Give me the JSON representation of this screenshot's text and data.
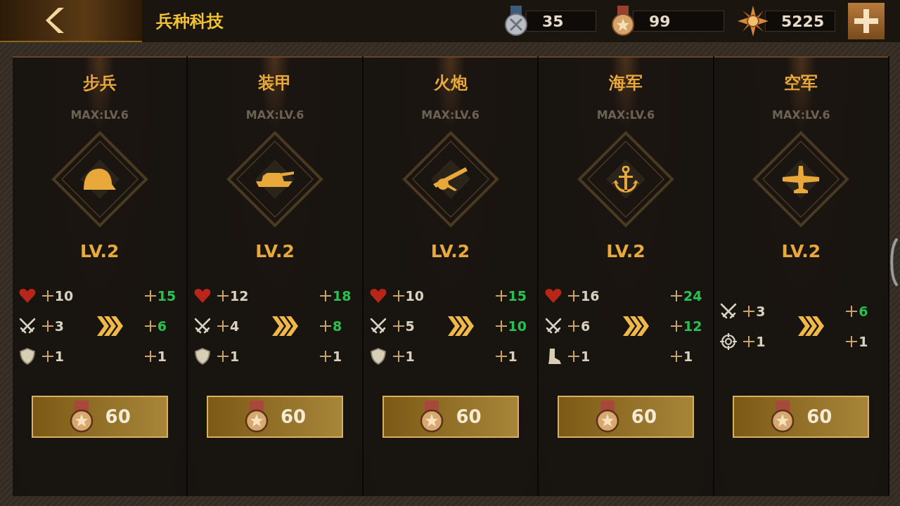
{
  "header": {
    "title": "兵种科技"
  },
  "currencies": [
    {
      "kind": "crossed-medal",
      "amount": "35"
    },
    {
      "kind": "star-medal",
      "amount": "99"
    },
    {
      "kind": "star-badge",
      "amount": "5225"
    }
  ],
  "branches": [
    {
      "name": "步兵",
      "max_level": "MAX:LV.6",
      "kind": "helmet",
      "level": "LV.2",
      "stats": [
        {
          "kind": "health",
          "current": "10",
          "next": "15",
          "improved": true
        },
        {
          "kind": "attack",
          "current": "3",
          "next": "6",
          "improved": true
        },
        {
          "kind": "defense",
          "current": "1",
          "next": "1",
          "improved": false
        }
      ],
      "cost": "60"
    },
    {
      "name": "装甲",
      "max_level": "MAX:LV.6",
      "kind": "tank",
      "level": "LV.2",
      "stats": [
        {
          "kind": "health",
          "current": "12",
          "next": "18",
          "improved": true
        },
        {
          "kind": "attack",
          "current": "4",
          "next": "8",
          "improved": true
        },
        {
          "kind": "defense",
          "current": "1",
          "next": "1",
          "improved": false
        }
      ],
      "cost": "60"
    },
    {
      "name": "火炮",
      "max_level": "MAX:LV.6",
      "kind": "cannon",
      "level": "LV.2",
      "stats": [
        {
          "kind": "health",
          "current": "10",
          "next": "15",
          "improved": true
        },
        {
          "kind": "attack",
          "current": "5",
          "next": "10",
          "improved": true
        },
        {
          "kind": "defense",
          "current": "1",
          "next": "1",
          "improved": false
        }
      ],
      "cost": "60"
    },
    {
      "name": "海军",
      "max_level": "MAX:LV.6",
      "kind": "anchor",
      "level": "LV.2",
      "stats": [
        {
          "kind": "health",
          "current": "16",
          "next": "24",
          "improved": true
        },
        {
          "kind": "attack",
          "current": "6",
          "next": "12",
          "improved": true
        },
        {
          "kind": "speed",
          "current": "1",
          "next": "1",
          "improved": false
        }
      ],
      "cost": "60"
    },
    {
      "name": "空军",
      "max_level": "MAX:LV.6",
      "kind": "plane",
      "level": "LV.2",
      "stats": [
        {
          "kind": "attack",
          "current": "3",
          "next": "6",
          "improved": true
        },
        {
          "kind": "accuracy",
          "current": "1",
          "next": "1",
          "improved": false
        }
      ],
      "cost": "60"
    }
  ]
}
